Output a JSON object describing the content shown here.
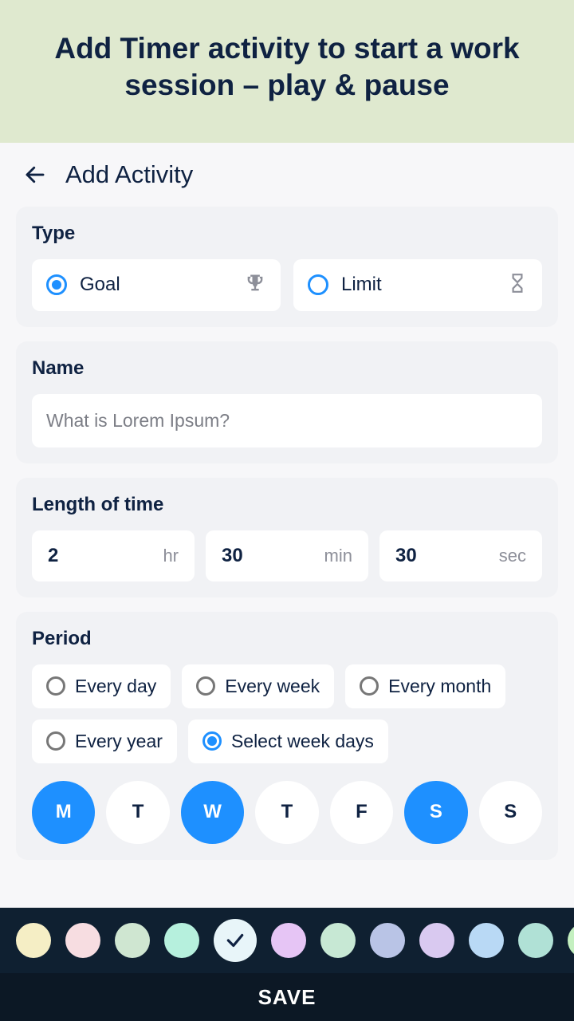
{
  "banner": "Add Timer activity to start a work session – play & pause",
  "header": {
    "title": "Add Activity"
  },
  "type": {
    "label": "Type",
    "goal": "Goal",
    "limit": "Limit"
  },
  "name": {
    "label": "Name",
    "placeholder": "What is Lorem Ipsum?"
  },
  "length": {
    "label": "Length of time",
    "hr_val": "2",
    "hr_unit": "hr",
    "min_val": "30",
    "min_unit": "min",
    "sec_val": "30",
    "sec_unit": "sec"
  },
  "period": {
    "label": "Period",
    "options": {
      "day": "Every day",
      "week": "Every week",
      "month": "Every month",
      "year": "Every year",
      "select": "Select week days"
    },
    "days": {
      "mon": "M",
      "tue": "T",
      "wed": "W",
      "thu": "T",
      "fri": "F",
      "sat": "S",
      "sun": "S"
    }
  },
  "colors": [
    "#f5eec5",
    "#f7dde1",
    "#cfe6d1",
    "#b6f0dd",
    "#e8f5f9",
    "#e6c5f5",
    "#c7e8d4",
    "#b9c4e6",
    "#d9c9f0",
    "#b9d9f5",
    "#b0e1d6",
    "#c4f0c0"
  ],
  "save": "SAVE"
}
